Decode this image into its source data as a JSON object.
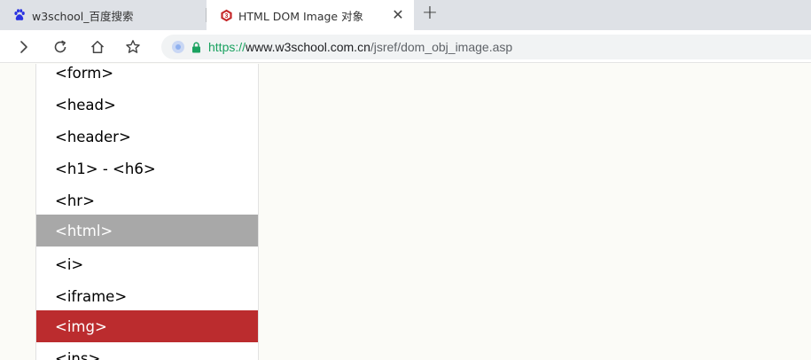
{
  "tabs": [
    {
      "title": "w3school_百度搜索",
      "favicon": "baidu-paw-icon",
      "active": false
    },
    {
      "title": "HTML DOM Image 对象",
      "favicon": "w3school-logo-icon",
      "active": true
    }
  ],
  "toolbar": {
    "url_scheme": "https://",
    "url_host": "www.w3school.com.cn",
    "url_path": "/jsref/dom_obj_image.asp"
  },
  "sidebar": {
    "items": [
      {
        "label": "<form>",
        "state": "normal"
      },
      {
        "label": "<head>",
        "state": "normal"
      },
      {
        "label": "<header>",
        "state": "normal"
      },
      {
        "label": "<h1> - <h6>",
        "state": "normal"
      },
      {
        "label": "<hr>",
        "state": "normal"
      },
      {
        "label": "<html>",
        "state": "hover"
      },
      {
        "label": "<i>",
        "state": "normal"
      },
      {
        "label": "<iframe>",
        "state": "normal"
      },
      {
        "label": "<img>",
        "state": "current"
      },
      {
        "label": "<ins>",
        "state": "normal"
      }
    ]
  },
  "colors": {
    "current_item": "#bb2c2e",
    "hover_item": "#a8a8a8",
    "secure_url": "#1aa260"
  }
}
